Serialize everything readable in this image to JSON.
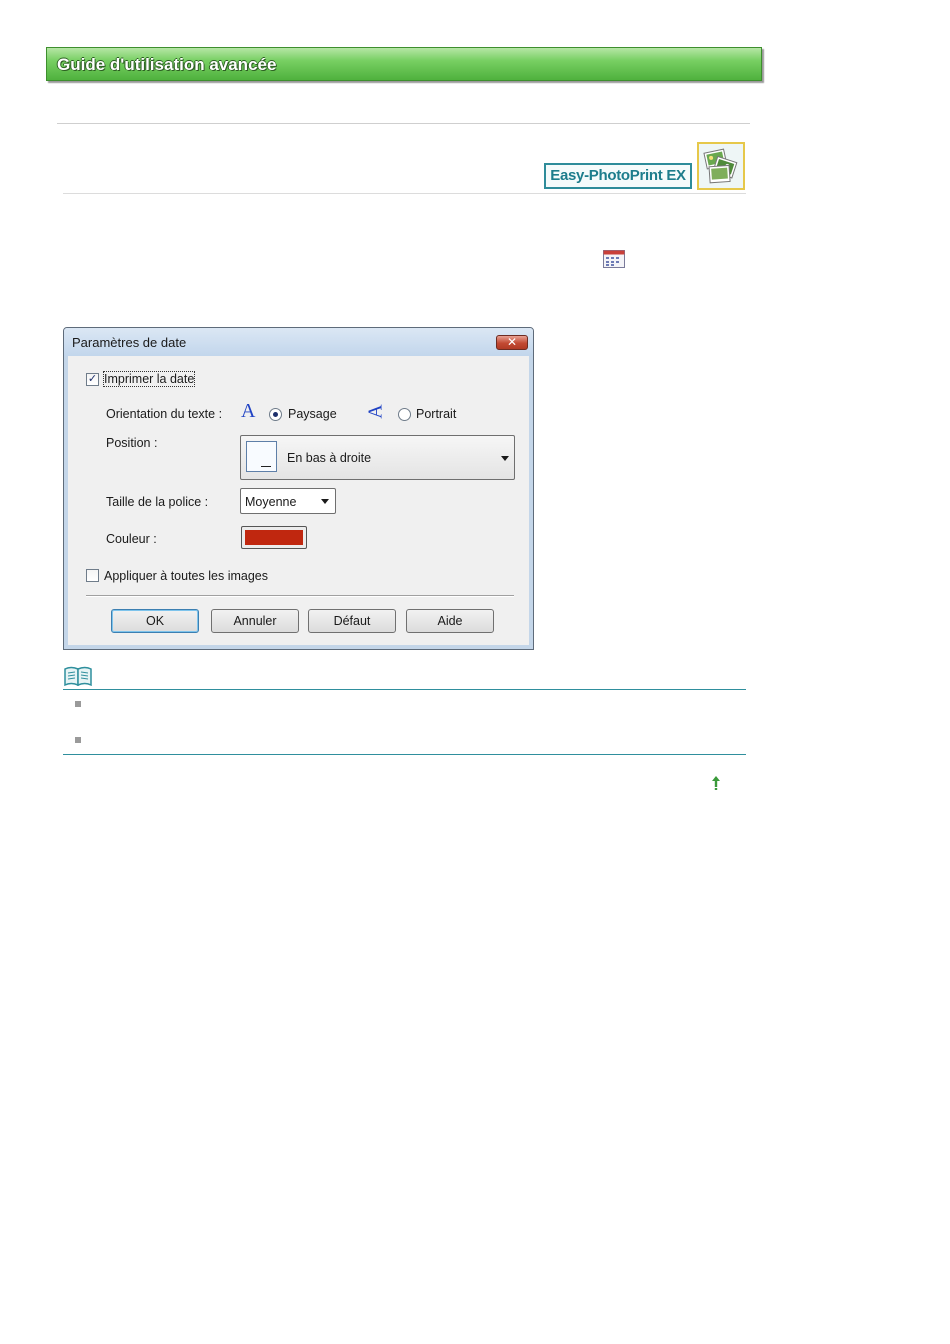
{
  "header": {
    "title": "Guide d'utilisation avancée"
  },
  "product_badge": {
    "label": "Easy-PhotoPrint EX",
    "icon": "photos-stack-icon"
  },
  "toolbar_icon": "calendar-icon",
  "dialog": {
    "title": "Paramètres de date",
    "close_label": "✕",
    "print_date": {
      "label": "Imprimer la date",
      "checked": true
    },
    "orientation": {
      "label": "Orientation du texte :",
      "options": [
        {
          "label": "Paysage",
          "selected": true,
          "icon": "landscape-a-icon"
        },
        {
          "label": "Portrait",
          "selected": false,
          "icon": "portrait-a-icon"
        }
      ]
    },
    "position": {
      "label": "Position :",
      "value": "En bas à droite"
    },
    "font_size": {
      "label": "Taille de la police :",
      "value": "Moyenne"
    },
    "color": {
      "label": "Couleur :",
      "value": "#c0270f"
    },
    "apply_all": {
      "label": "Appliquer à toutes les images",
      "checked": false
    },
    "buttons": {
      "ok": "OK",
      "cancel": "Annuler",
      "default": "Défaut",
      "help": "Aide"
    }
  },
  "note": {
    "icon": "book-icon",
    "bullet_count": 2
  },
  "page_top_icon": "up-arrow-icon",
  "colors": {
    "header_green": "#4fb13d",
    "teal": "#2f8f9d",
    "date_color": "#c0270f"
  }
}
